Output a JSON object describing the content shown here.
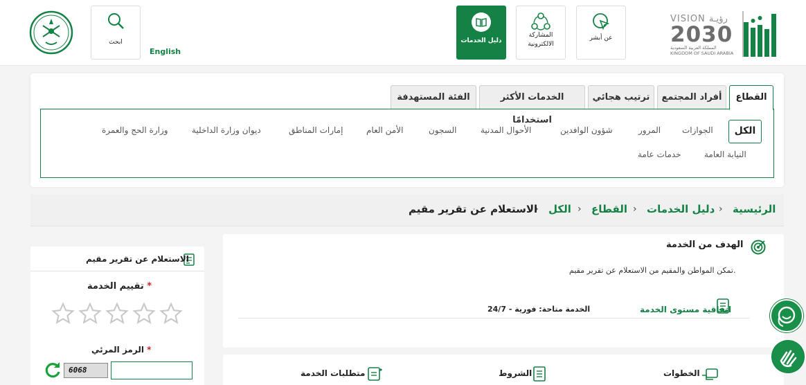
{
  "header": {
    "english_link": "English",
    "search_label": "ابحث",
    "about_label": "عن أبشر",
    "participation_label_1": "المشاركة",
    "participation_label_2": "الالكترونية",
    "services_guide_label": "دليل الخدمات",
    "vision_title": "VISION رؤيـة",
    "vision_year": "2030",
    "vision_sub_ar": "المملكة العربية السعودية",
    "vision_sub_en": "KINGDOM OF SAUDI ARABIA"
  },
  "tabs": [
    {
      "label": "القطاع"
    },
    {
      "label": "أفراد المجتمع"
    },
    {
      "label": "ترتيب هجائي"
    },
    {
      "label": "الخدمات الأكثر استخدامًا"
    },
    {
      "label": "الفئة المستهدفة"
    }
  ],
  "sectors": {
    "all": "الكل",
    "row1": [
      "الجوازات",
      "المرور",
      "شؤون الوافدين",
      "الأحوال المدنية",
      "السجون",
      "الأمن العام",
      "إمارات المناطق",
      "ديوان وزارة الداخلية",
      "وزارة الحج والعمرة"
    ],
    "row2": [
      "النيابة العامة",
      "خدمات عامة"
    ]
  },
  "breadcrumb": {
    "home": "الرئيسية",
    "guide": "دليل الخدمات",
    "sector": "القطاع",
    "all": "الكل",
    "current": "الاستعلام عن تقرير مقيم",
    "sep": "›"
  },
  "service": {
    "goal_title": "الهدف من الخدمة",
    "goal_desc": "تمكن المواطن والمقيم من الاستعلام عن تقرير مقيم.",
    "sla_label": "اتفاقية مستوى الخدمة",
    "sla_value": "الخدمة متاحة: فورية - 24/7"
  },
  "sections": {
    "steps": "الخطوات",
    "terms": "الشروط",
    "requirements": "متطلبات الخدمة"
  },
  "side": {
    "title": "الاستعلام عن تقرير مقيم",
    "rating_label": "تقييم الخدمة",
    "captcha_label": "الرمز المرئي",
    "required_mark": "*",
    "captcha_text": "6068",
    "captcha_value": ""
  },
  "colors": {
    "brand_green": "#138244",
    "required_red": "#c62828"
  }
}
